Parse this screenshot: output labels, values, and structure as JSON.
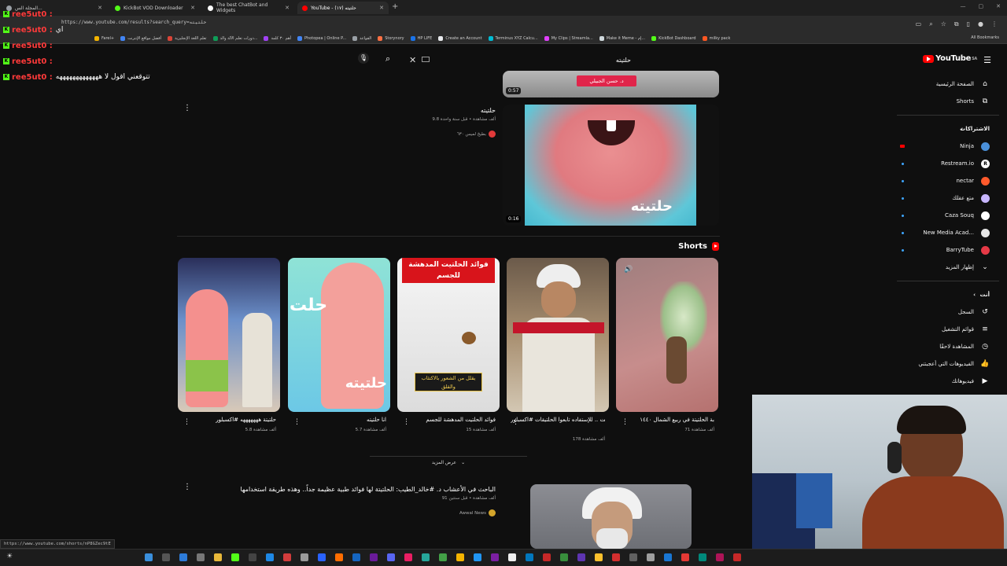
{
  "chat": [
    {
      "user": "ree5ut0 :",
      "msg": ""
    },
    {
      "user": "ree5ut0 :",
      "msg": "اي"
    },
    {
      "user": "ree5ut0 :",
      "msg": ""
    },
    {
      "user": "ree5ut0 :",
      "msg": ""
    },
    {
      "user": "ree5ut0 :",
      "msg": "تتوقعني اقول لا هههههههههههههه"
    }
  ],
  "browser": {
    "tabs": [
      {
        "label": "المجلة الس...",
        "color": "#9aa0a6"
      },
      {
        "label": "KickBot VOD Downloader",
        "color": "#53fc18"
      },
      {
        "label": "The best ChatBot and Widgets",
        "color": "#ffffff"
      },
      {
        "label": "YouTube - حلتيته (١٧)",
        "color": "#ff0000",
        "active": true
      }
    ],
    "url": "https://www.youtube.com/results?search_query=حلتيته",
    "new_tab": "+",
    "bookmarks": [
      "Farel+",
      "أفضل مواقع الإنترنت",
      "تعلم اللغة الإنجليزية",
      "دورات تعلم الآلة والذ...",
      "أهم ٣٠ كلمة",
      "Photopea | Online P...",
      "القواعد",
      "Storynory",
      "HP LIFE",
      "Create an Account",
      "Terminus XYZ Calcu...",
      "My Clips | Streamla...",
      "Make it Meme - إم...",
      "KickBot Dashboard",
      "milky pack"
    ],
    "all_bookmarks": "All Bookmarks",
    "status_url": "https://www.youtube.com/shorts/nP8GZec9tE"
  },
  "header": {
    "search_query": "حلتيته",
    "logo_text": "YouTube",
    "logo_region": "SA"
  },
  "sidebar": {
    "items": [
      {
        "label": "الصفحة الرئيسية",
        "icon": "home-icon"
      },
      {
        "label": "Shorts",
        "icon": "shorts-icon"
      }
    ],
    "subs_header": "الاشتراكات",
    "subs": [
      {
        "label": "Ninja",
        "color": "#4a90d9",
        "live": false,
        "rec": true
      },
      {
        "label": "Restream.io",
        "color": "#ffffff",
        "live": true,
        "letter": "R"
      },
      {
        "label": "nectar",
        "color": "#ff5a2c",
        "live": true
      },
      {
        "label": "متع عقلك",
        "color": "#c8b6ff",
        "live": true
      },
      {
        "label": "Caza Souq",
        "color": "#ffffff",
        "live": true
      },
      {
        "label": "New Media Acad...",
        "color": "#e6e6e6",
        "live": true
      },
      {
        "label": "BarryTube",
        "color": "#e63946",
        "live": true
      }
    ],
    "show_more": "إظهار المزيد",
    "you_header": "أنت",
    "you": [
      {
        "label": "السجل",
        "icon": "history-icon"
      },
      {
        "label": "قوائم التشغيل",
        "icon": "playlist-icon"
      },
      {
        "label": "المشاهدة لاحقًا",
        "icon": "clock-icon"
      },
      {
        "label": "الفيديوهات التي أعجبتني",
        "icon": "like-icon"
      },
      {
        "label": "فيديوهاتك",
        "icon": "video-icon"
      }
    ]
  },
  "videos": [
    {
      "duration": "0:57",
      "overlay_text": "د. حسن الجبيلي"
    },
    {
      "title": "حلتيته",
      "meta": "9.8 ألف مشاهدة • قبل سنة واحدة",
      "channel": "بطيخ لميس ٦٣٠",
      "duration": "0:16",
      "overlay_text": "حلتيته"
    },
    {
      "title": "الباحث في الأعشاب د. #خالد_الطيب: الحلتيتة لها فوائد طبية عظيمة جداً.. وهذه طريقة استخدامها",
      "meta": "91 ألف مشاهدة • قبل سنتين",
      "channel": "Awwal News"
    }
  ],
  "shorts": {
    "header": "Shorts",
    "items": [
      {
        "title": "حلتيتة هههههههه #اكسبلور",
        "views": "5.8 ألف مشاهدة"
      },
      {
        "title": "انا حلتيته",
        "views": "5.7 ألف مشاهدة",
        "overlay": "حلتيته"
      },
      {
        "title": "فوائد الحلتيت المدهشة للجسم",
        "views": "15 ألف مشاهدة",
        "overlay_top": "فوائد الحلتيت المدهشة للجسم",
        "overlay_bottom": "يقلل من الشعور بالاكتئاب والقلق"
      },
      {
        "title": "الحلتيت وما أدراك ماهو الحلتيت .. للإستفاده تابعوا الحلتيقات #اكسبلور",
        "views": "178 ألف مشاهدة"
      },
      {
        "title": "بة الحلتيتة في ربيع الشمال ١٤٤٠",
        "views": "71 ألف مشاهدة"
      }
    ],
    "show_more": "عرض المزيد"
  }
}
